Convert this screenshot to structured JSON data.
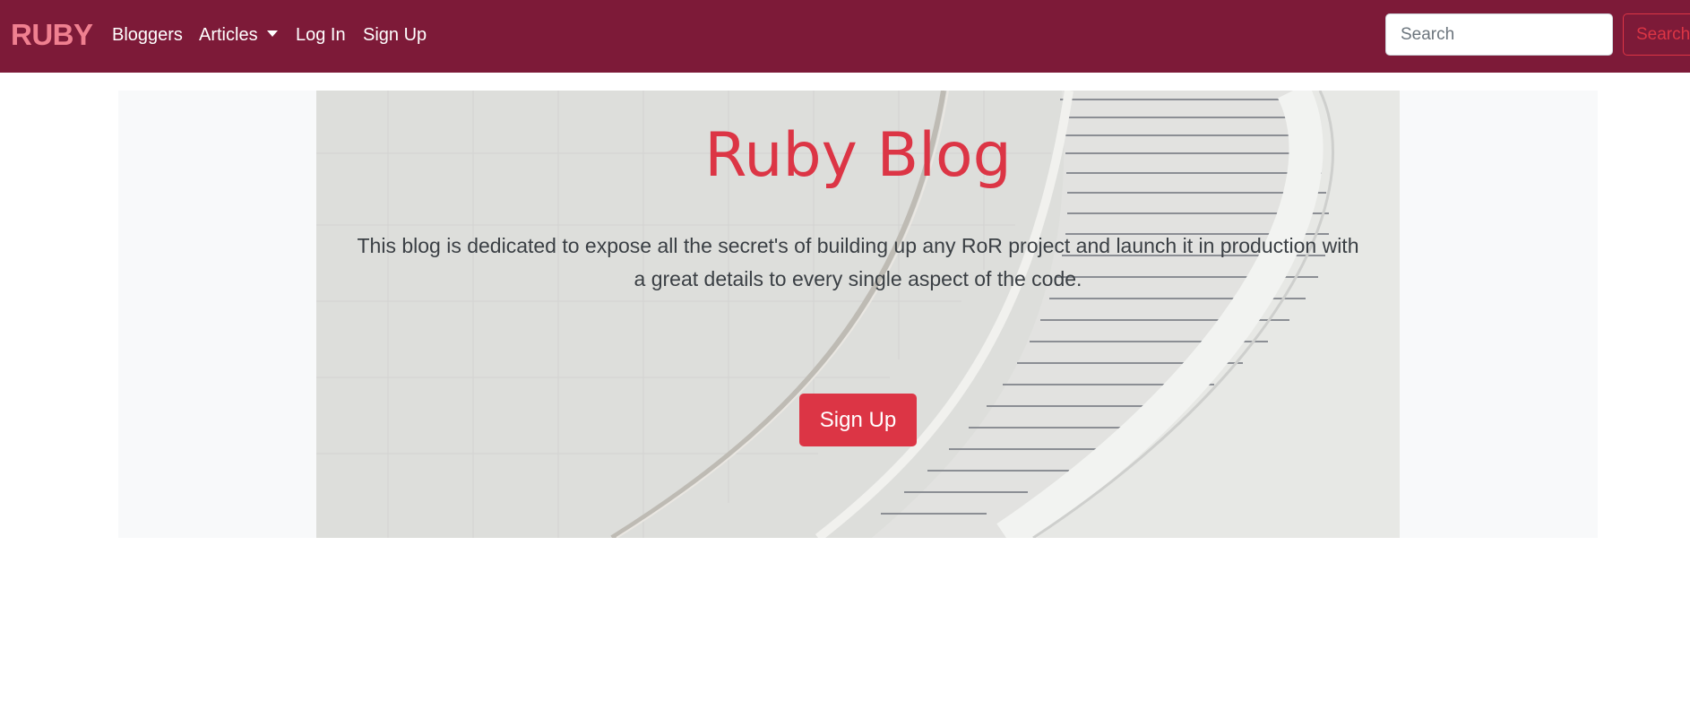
{
  "navbar": {
    "brand": "RUBY",
    "links": {
      "bloggers": "Bloggers",
      "articles": "Articles",
      "login": "Log In",
      "signup": "Sign Up"
    },
    "search": {
      "placeholder": "Search",
      "button_label": "Search"
    }
  },
  "hero": {
    "title": "Ruby Blog",
    "description": "This blog is dedicated to expose all the secret's of building up any RoR project and launch it in production with a great details to every single aspect of the code.",
    "cta_label": "Sign Up"
  },
  "colors": {
    "navbar_bg": "#7d1a38",
    "brand": "#f08090",
    "accent": "#dc3545",
    "jumbotron_bg": "#f8f9fa"
  }
}
